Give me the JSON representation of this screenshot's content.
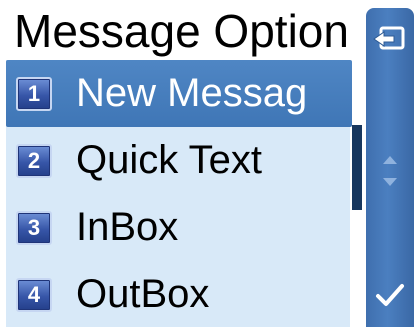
{
  "header": {
    "title": "Message Option"
  },
  "menu": {
    "items": [
      {
        "number": "1",
        "label": "New Messag",
        "selected": true
      },
      {
        "number": "2",
        "label": "Quick Text",
        "selected": false
      },
      {
        "number": "3",
        "label": "InBox",
        "selected": false
      },
      {
        "number": "4",
        "label": "OutBox",
        "selected": false
      }
    ]
  },
  "softkeys": {
    "top_icon": "back-icon",
    "middle_icon": "up-down-arrows-icon",
    "bottom_icon": "checkmark-icon"
  },
  "colors": {
    "list_background": "#d8e9f8",
    "selection": "#4a80c2",
    "softbar": "#4778b8",
    "number_badge": "#3756a8"
  }
}
